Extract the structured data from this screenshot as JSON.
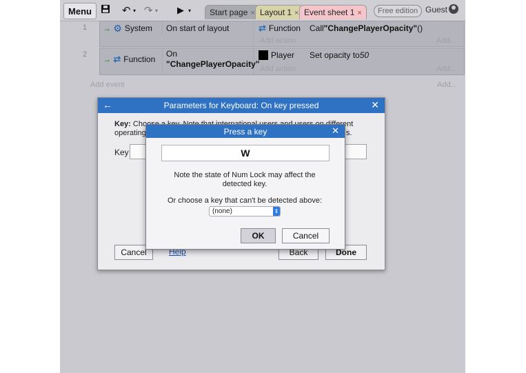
{
  "toolbar": {
    "menu_label": "Menu",
    "tabs": [
      {
        "label": "Start page",
        "close": "×"
      },
      {
        "label": "Layout 1",
        "close": "×"
      },
      {
        "label": "Event sheet 1",
        "close": "×"
      }
    ],
    "free_edition": "Free edition",
    "guest": "Guest"
  },
  "events": [
    {
      "number": "1",
      "object": "System",
      "condition": "On start of layout",
      "action_object": "Function",
      "action_prefix": "Call ",
      "action_name": "\"ChangePlayerOpacity\"",
      "action_suffix": " ()",
      "add_action": "Add action",
      "add_action_right": "Add..."
    },
    {
      "number": "2",
      "object": "Function",
      "condition_line1": "On",
      "condition_line2": "\"ChangePlayerOpacity\"",
      "action_object": "Player",
      "action_prefix": "Set opacity to ",
      "action_value": "50",
      "add_action": "Add action",
      "add_action_right": "Add..."
    }
  ],
  "add_event": "Add event",
  "add_event_right": "Add...",
  "param_dialog": {
    "title": "Parameters for Keyboard: On key pressed",
    "desc_bold": "Key:",
    "desc_text": " Choose a key. Note that international users and users on different operating",
    "desc_tail": "s.",
    "key_label": "Key",
    "cancel": "Cancel",
    "help": "Help",
    "back": "Back",
    "done": "Done"
  },
  "press_dialog": {
    "title": "Press a key",
    "key": "W",
    "note": "Note the state of Num Lock may affect the detected key.",
    "or_choose": "Or choose a key that can't be detected above:",
    "select_value": "(none)",
    "ok": "OK",
    "cancel": "Cancel"
  }
}
